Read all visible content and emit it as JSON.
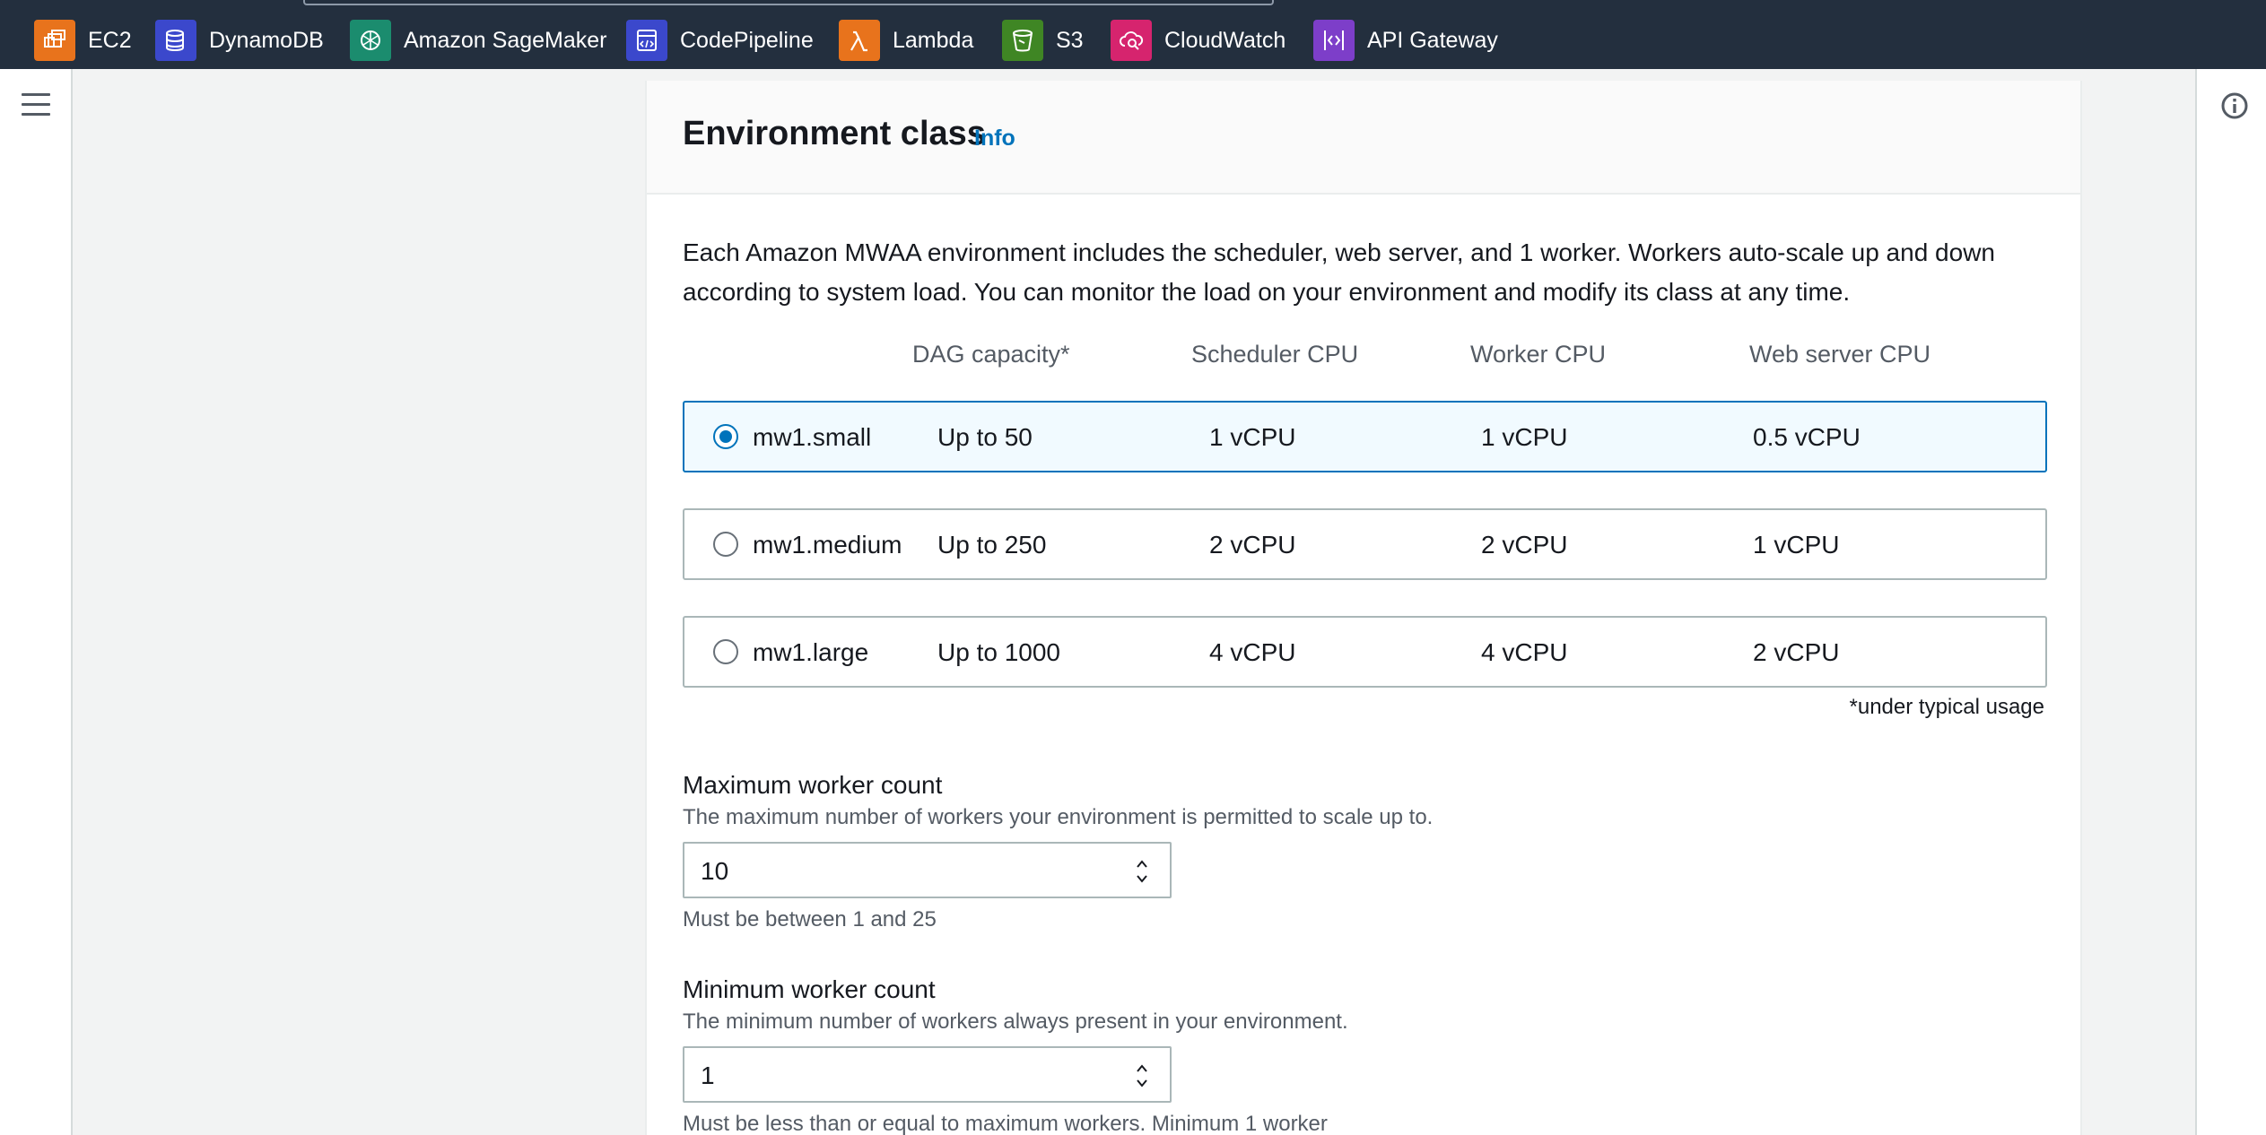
{
  "favorites": [
    {
      "label": "EC2",
      "icon": "ec2-icon",
      "color": "#e8731c"
    },
    {
      "label": "DynamoDB",
      "icon": "dynamodb-icon",
      "color": "#3b48cc"
    },
    {
      "label": "Amazon SageMaker",
      "icon": "sagemaker-icon",
      "color": "#1b8c6e"
    },
    {
      "label": "CodePipeline",
      "icon": "codepipeline-icon",
      "color": "#3b48cc"
    },
    {
      "label": "Lambda",
      "icon": "lambda-icon",
      "color": "#e8731c"
    },
    {
      "label": "S3",
      "icon": "s3-icon",
      "color": "#3f8624"
    },
    {
      "label": "CloudWatch",
      "icon": "cloudwatch-icon",
      "color": "#d6246e"
    },
    {
      "label": "API Gateway",
      "icon": "api-gateway-icon",
      "color": "#7d3ec9"
    }
  ],
  "section": {
    "title": "Environment class",
    "info_label": "Info",
    "description": "Each Amazon MWAA environment includes the scheduler, web server, and 1 worker. Workers auto-scale up and down according to system load. You can monitor the load on your environment and modify its class at any time."
  },
  "table": {
    "headers": [
      "DAG capacity*",
      "Scheduler CPU",
      "Worker CPU",
      "Web server CPU"
    ],
    "rows": [
      {
        "name": "mw1.small",
        "dag": "Up to 50",
        "scheduler": "1 vCPU",
        "worker": "1 vCPU",
        "webserver": "0.5 vCPU",
        "selected": true
      },
      {
        "name": "mw1.medium",
        "dag": "Up to 250",
        "scheduler": "2 vCPU",
        "worker": "2 vCPU",
        "webserver": "1 vCPU",
        "selected": false
      },
      {
        "name": "mw1.large",
        "dag": "Up to 1000",
        "scheduler": "4 vCPU",
        "worker": "4 vCPU",
        "webserver": "2 vCPU",
        "selected": false
      }
    ],
    "footnote": "*under typical usage"
  },
  "max_workers": {
    "label": "Maximum worker count",
    "description": "The maximum number of workers your environment is permitted to scale up to.",
    "value": "10",
    "hint": "Must be between 1 and 25"
  },
  "min_workers": {
    "label": "Minimum worker count",
    "description": "The minimum number of workers always present in your environment.",
    "value": "1",
    "hint": "Must be less than or equal to maximum workers. Minimum 1 worker"
  },
  "colors": {
    "nav_bg": "#232f3e",
    "link": "#0073bb",
    "selected_bg": "#f1faff"
  }
}
